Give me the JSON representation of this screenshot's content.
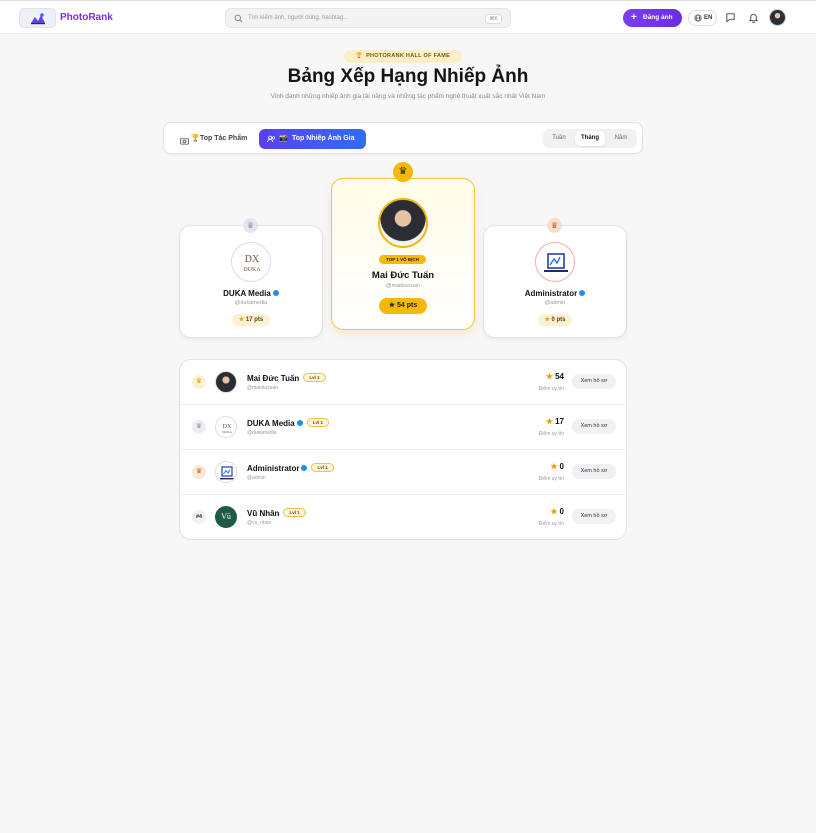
{
  "header": {
    "brand": "PhotoRank",
    "search_placeholder": "Tìm kiếm ảnh, người dùng, hashtag...",
    "search_shortcut": "⌘K",
    "post_button": "Đăng ảnh",
    "lang_button": "EN"
  },
  "hero": {
    "badge": "PHOTORANK HALL OF FAME",
    "title": "Bảng Xếp Hạng Nhiếp Ảnh",
    "subtitle": "Vinh danh những nhiếp ảnh gia tài năng và những tác phẩm nghệ thuật xuất sắc nhất Việt Nam"
  },
  "tabs": {
    "works": "Top Tác Phẩm",
    "photographers": "Top Nhiếp Ảnh Gia",
    "period": [
      "Tuần",
      "Tháng",
      "Năm"
    ],
    "active_period": "Tháng"
  },
  "podium": {
    "first": {
      "badge": "TOP 1 VÔ ĐỊCH",
      "name": "Mai Đức Tuấn",
      "handle": "@maiductuan",
      "points": "54 pts"
    },
    "second": {
      "name": "DUKA Media",
      "handle": "@dukamedia",
      "points": "17 pts"
    },
    "third": {
      "name": "Administrator",
      "handle": "@admin",
      "points": "0 pts"
    }
  },
  "ranking": {
    "score_label": "Điểm uy tín",
    "view_button": "Xem hồ sơ",
    "rows": [
      {
        "rank_label": "",
        "name": "Mai Đức Tuấn",
        "level": "Lvl 1",
        "handle": "@maiductuan",
        "score": "54"
      },
      {
        "rank_label": "",
        "name": "DUKA Media",
        "level": "Lvl 1",
        "handle": "@dukamedia",
        "score": "17"
      },
      {
        "rank_label": "",
        "name": "Administrator",
        "level": "Lvl 1",
        "handle": "@admin",
        "score": "0"
      },
      {
        "rank_label": "#4",
        "name": "Vũ Nhân",
        "level": "Lvl 1",
        "handle": "@vu_nhan",
        "score": "0"
      }
    ]
  },
  "avatars": {
    "vu_nhan_initials": "Vũ",
    "duka_text": "DUKA"
  },
  "colors": {
    "brand": "#7c2fd6",
    "accent_gradient_start": "#5b3ff0",
    "accent_gradient_end": "#2f6df6",
    "gold": "#f5b90a"
  },
  "icons": {
    "search": "search-icon",
    "plus": "plus-icon",
    "globe": "globe-icon",
    "chat": "chat-icon",
    "bell": "bell-icon",
    "trophy": "trophy-icon",
    "crown": "crown-icon",
    "star": "star-icon",
    "camera": "camera-icon",
    "users": "users-icon"
  }
}
